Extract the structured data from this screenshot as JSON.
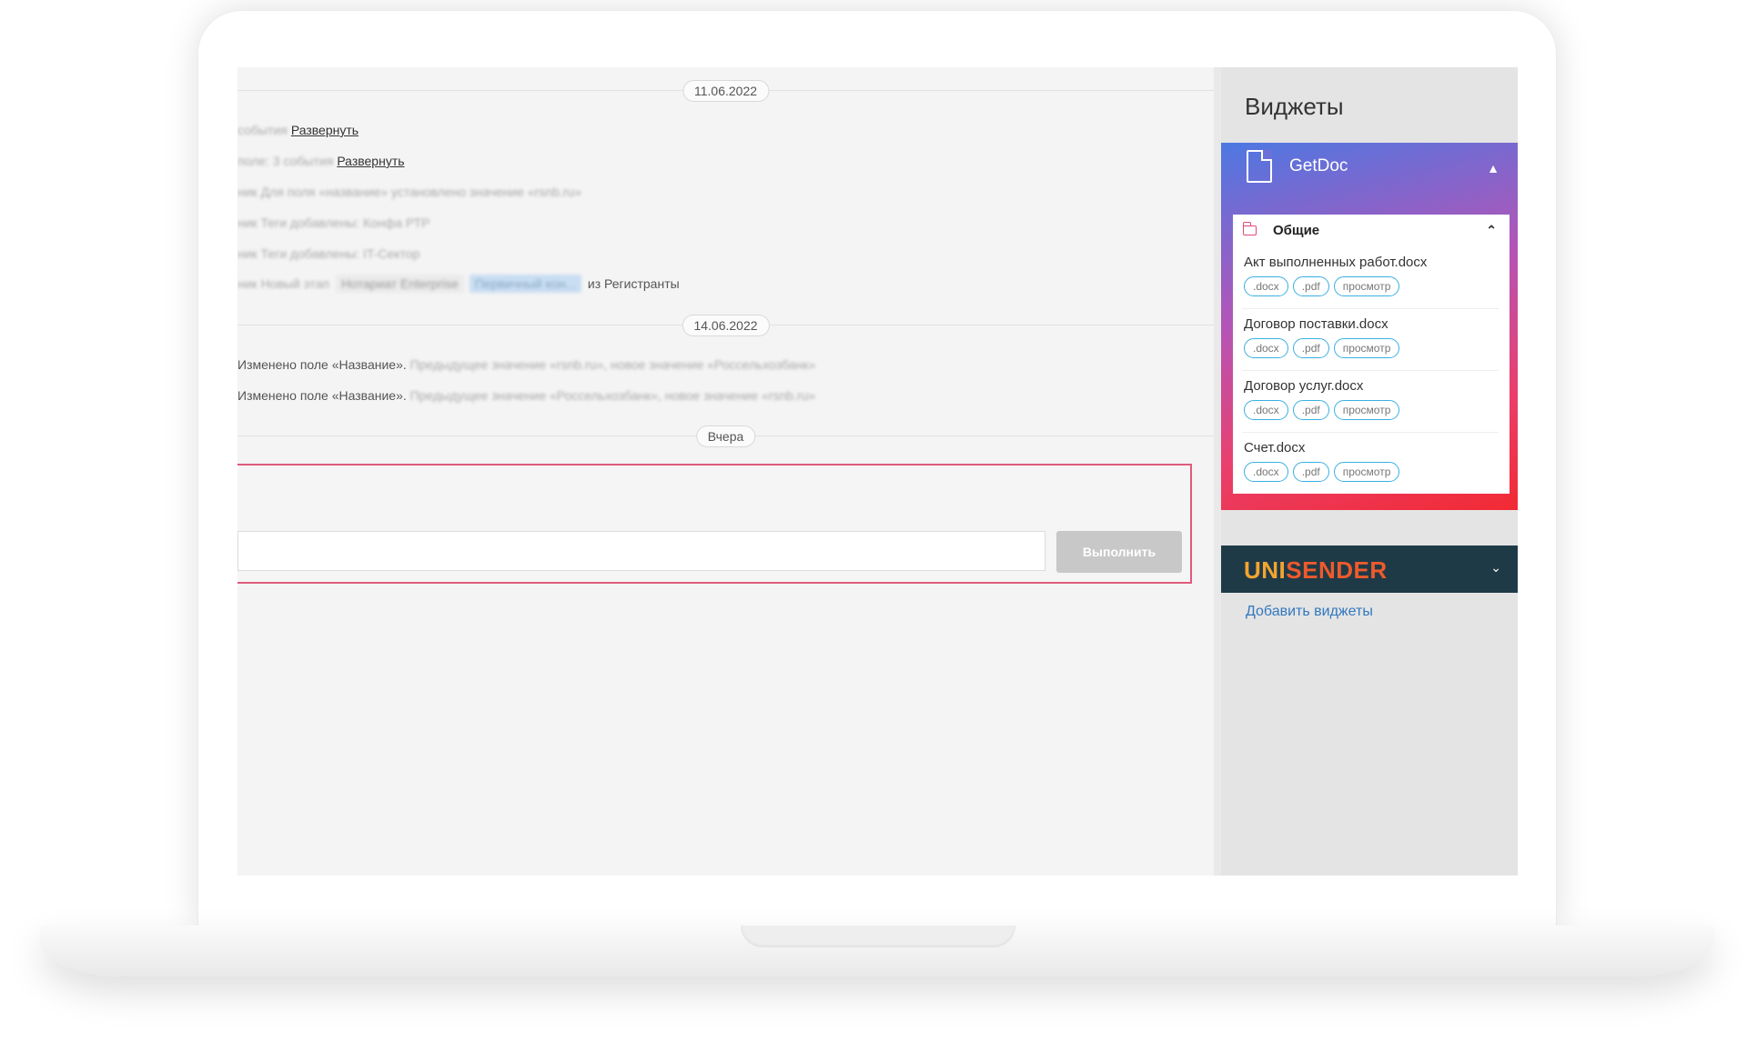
{
  "feed": {
    "date_1": "11.06.2022",
    "event_1": {
      "text": "события",
      "link": "Развернуть"
    },
    "event_2": {
      "text": "поле: 3 события",
      "link": "Развернуть"
    },
    "event_3": {
      "text": "ник Для поля «название» установлено значение «rsnb.ru»"
    },
    "event_4": {
      "text": "ник Теги добавлены: Конфа РТР"
    },
    "event_5": {
      "text": "ник Теги добавлены: IT-Сектор"
    },
    "event_6": {
      "prefix": "ник Новый этап",
      "tag_from": "Нотариат Enterprise",
      "tag_to": "Первичный кон...",
      "suffix": "из Регистранты"
    },
    "date_2": "14.06.2022",
    "event_7": {
      "text": "Изменено поле «Название».",
      "detail": "Предыдущее значение «rsnb.ru», новое значение «Россельхозбанк»"
    },
    "event_8": {
      "text": "Изменено поле «Название».",
      "detail": "Предыдущее значение «Россельхозбанк», новое значение «rsnb.ru»"
    },
    "date_3": "Вчера",
    "composer": {
      "submit_label": "Выполнить",
      "placeholder": ""
    }
  },
  "sidebar": {
    "title": "Виджеты",
    "getdoc": {
      "name": "GetDoc",
      "folder": "Общие",
      "documents": [
        {
          "name": "Акт выполненных работ.docx",
          "actions": [
            ".docx",
            ".pdf",
            "просмотр"
          ]
        },
        {
          "name": "Договор поставки.docx",
          "actions": [
            ".docx",
            ".pdf",
            "просмотр"
          ]
        },
        {
          "name": "Договор услуг.docx",
          "actions": [
            ".docx",
            ".pdf",
            "просмотр"
          ]
        },
        {
          "name": "Счет.docx",
          "actions": [
            ".docx",
            ".pdf",
            "просмотр"
          ]
        }
      ]
    },
    "unisender": {
      "logo_part_1": "UNI",
      "logo_part_2": "SENDER"
    },
    "add_widgets": "Добавить виджеты"
  },
  "icons": {
    "getdoc_icon": "document-icon",
    "folder_icon": "folder-icon",
    "collapse_icon": "chevron-up-icon",
    "expand_icon": "chevron-down-icon"
  },
  "colors": {
    "composer_border": "#e05a7c",
    "getdoc_gradient_start": "#4d78e2",
    "getdoc_gradient_end": "#f22a33",
    "unisender_bg": "#1f3a47",
    "unisender_uni": "#f3a430",
    "unisender_sender": "#ef5a2b",
    "chip_border": "#3ab0e2",
    "link": "#3278c0"
  }
}
